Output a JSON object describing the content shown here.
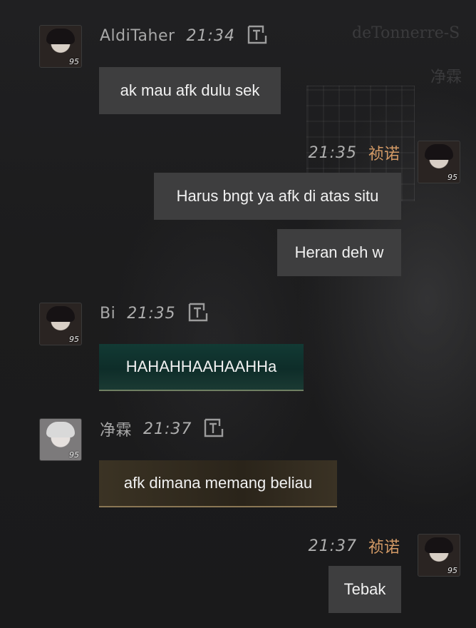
{
  "colors": {
    "background": "#1c1c1d",
    "bubble": "#3e3e3f",
    "self_name": "#d39a66",
    "name": "#a7a7a7"
  },
  "background_text": {
    "line1": "deTonnerre-S",
    "line2": "净霖"
  },
  "messages": [
    {
      "sender": "AldiTaher",
      "time": "21:34",
      "level": "95",
      "side": "left",
      "icon": "translate-icon",
      "texts": [
        "ak mau afk dulu sek"
      ]
    },
    {
      "sender": "祯诺",
      "time": "21:35",
      "level": "95",
      "side": "right",
      "texts": [
        "Harus bngt ya afk di atas situ",
        "Heran deh w"
      ]
    },
    {
      "sender": "Bi",
      "time": "21:35",
      "level": "95",
      "side": "left",
      "icon": "translate-icon",
      "texts": [
        "HAHAHHAAHAAHHa"
      ]
    },
    {
      "sender": "净霖",
      "time": "21:37",
      "level": "95",
      "side": "left",
      "icon": "translate-icon",
      "texts": [
        "afk dimana memang beliau"
      ]
    },
    {
      "sender": "祯诺",
      "time": "21:37",
      "level": "95",
      "side": "right",
      "texts": [
        "Tebak"
      ]
    }
  ]
}
